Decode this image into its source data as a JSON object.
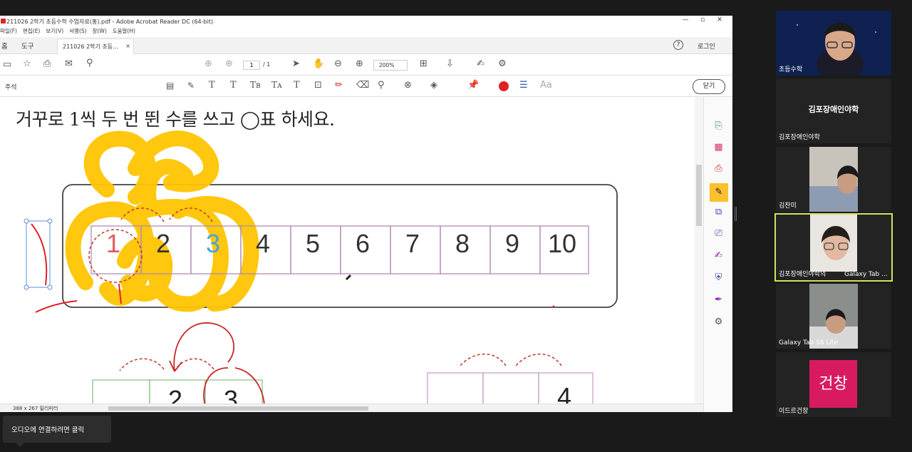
{
  "window": {
    "title": "211026 2학기 초등수학 수업자료(홍).pdf - Adobe Acrobat Reader DC (64-bit)",
    "controls": [
      "—",
      "▫",
      "✕"
    ]
  },
  "menu": [
    "파일(F)",
    "편집(E)",
    "보기(V)",
    "서명(S)",
    "창(W)",
    "도움말(H)"
  ],
  "tabs": {
    "home": "홈",
    "tools": "도구",
    "doc": "211026 2학기 초등...",
    "close": "×",
    "help": "?",
    "login": "로그인"
  },
  "toolbar": {
    "page_current": "1",
    "page_total": "/ 1",
    "zoom": "200%"
  },
  "comment_toolbar": {
    "label": "주석",
    "close": "닫기"
  },
  "document": {
    "heading": "거꾸로 1씩 두 번 뛴 수를 쓰고 ◯표 하세요.",
    "row_numbers": [
      "1",
      "2",
      "3",
      "4",
      "5",
      "6",
      "7",
      "8",
      "9",
      "10"
    ],
    "lower_left": [
      "",
      "2",
      "3"
    ],
    "lower_right": [
      "",
      "",
      "4"
    ]
  },
  "status": {
    "dimensions": "388 x 267 밀리미터"
  },
  "audio_tip": "오디오에 연결하려면 클릭",
  "participants": [
    {
      "name": "초등수학",
      "type": "video"
    },
    {
      "name": "김포장애인야학",
      "center_name": "김포장애인야학",
      "type": "name"
    },
    {
      "name": "김찬미",
      "type": "video"
    },
    {
      "name": "김포장애인야학의",
      "extra": "Galaxy Tab ...",
      "type": "video",
      "active": true
    },
    {
      "name": "Galaxy Tab S6 Lite",
      "type": "video"
    },
    {
      "name": "이드르건창",
      "badge": "건창",
      "type": "badge",
      "badge_color": "#d81b60"
    }
  ],
  "colors": {
    "accent_red": "#e31f26",
    "highlight_yellow": "#ffc400",
    "active_border": "#d4e157"
  }
}
